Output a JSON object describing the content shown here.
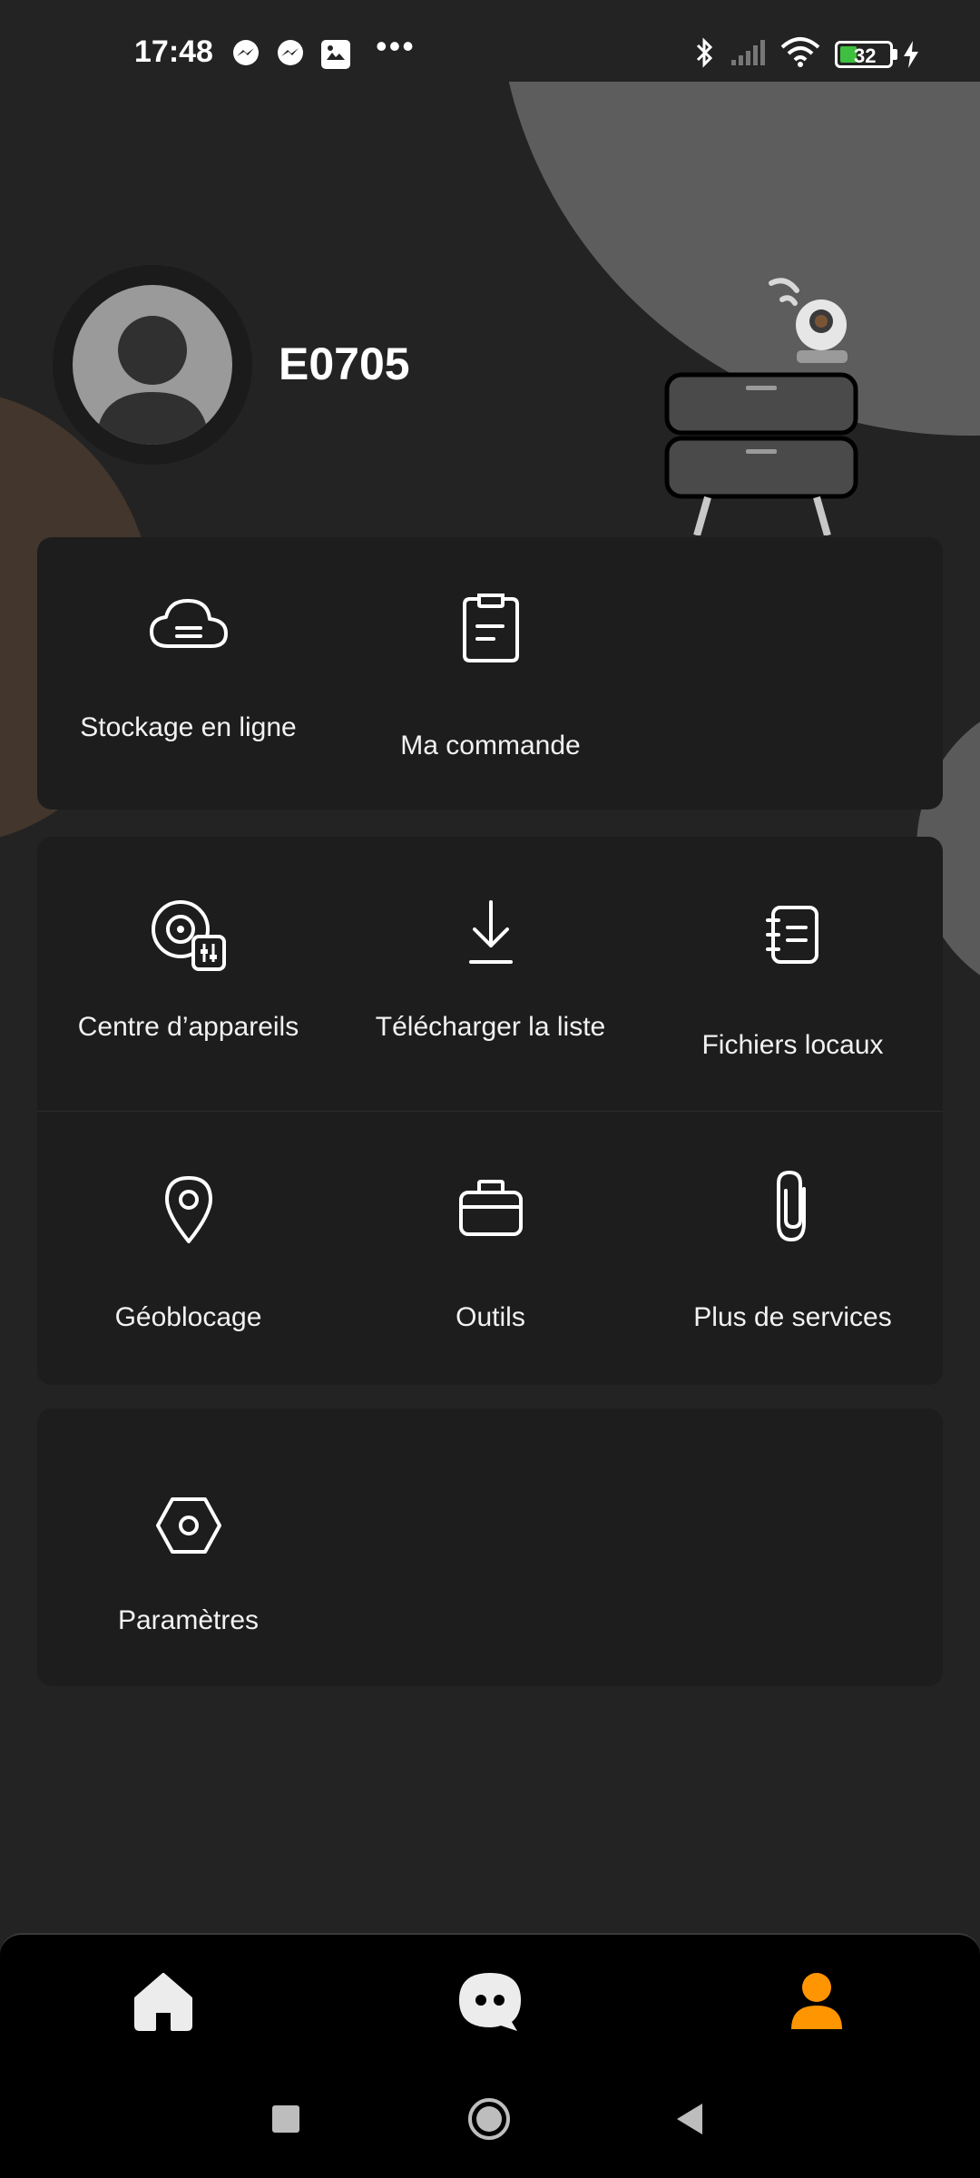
{
  "status_bar": {
    "time": "17:48",
    "notification_icons": [
      "messenger-icon",
      "messenger-icon",
      "image-icon"
    ],
    "overflow": "•••",
    "system_icons": [
      "bluetooth-icon",
      "signal-icon",
      "wifi-icon"
    ],
    "battery": "32"
  },
  "profile": {
    "username": "E0705"
  },
  "sections": {
    "primary": [
      {
        "label": "Stockage en ligne",
        "icon": "cloud-storage-icon"
      },
      {
        "label": "Ma commande",
        "icon": "clipboard-icon"
      }
    ],
    "devices": [
      {
        "label": "Centre d’appareils",
        "icon": "device-center-icon"
      },
      {
        "label": "Télécharger la liste",
        "icon": "download-icon"
      },
      {
        "label": "Fichiers locaux",
        "icon": "notebook-icon"
      },
      {
        "label": "Géoblocage",
        "icon": "location-pin-icon"
      },
      {
        "label": "Outils",
        "icon": "briefcase-icon"
      },
      {
        "label": "Plus de services",
        "icon": "paperclip-icon"
      }
    ],
    "settings": [
      {
        "label": "Paramètres",
        "icon": "hexagon-settings-icon"
      }
    ]
  },
  "bottom_nav": {
    "items": [
      {
        "icon": "home-icon",
        "active": false
      },
      {
        "icon": "chat-icon",
        "active": false
      },
      {
        "icon": "profile-icon",
        "active": true
      }
    ],
    "active_color": "#ff9500"
  },
  "system_nav": [
    "recents-button",
    "home-button",
    "back-button"
  ]
}
